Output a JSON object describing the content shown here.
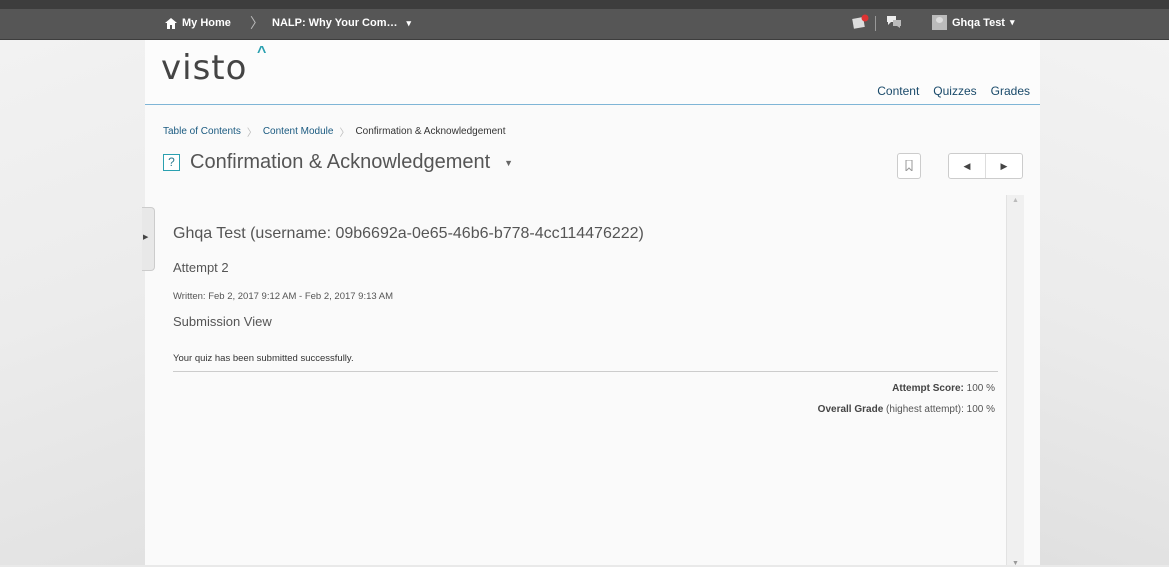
{
  "topbar": {
    "home_label": "My Home",
    "course_label": "NALP: Why Your Com…",
    "user_name": "Ghqa Test",
    "dropdown_glyph": "▾"
  },
  "header": {
    "logo": "visto",
    "nav": [
      "Content",
      "Quizzes",
      "Grades"
    ]
  },
  "breadcrumb": {
    "items": [
      "Table of Contents",
      "Content Module"
    ],
    "current": "Confirmation & Acknowledgement"
  },
  "page": {
    "title": "Confirmation & Acknowledgement",
    "title_icon": "?"
  },
  "submission": {
    "user_line": "Ghqa Test (username: 09b6692a-0e65-46b6-b778-4cc114476222)",
    "attempt": "Attempt 2",
    "written": "Written: Feb 2, 2017 9:12 AM - Feb 2, 2017 9:13 AM",
    "view_title": "Submission View",
    "message": "Your quiz has been submitted successfully.",
    "attempt_score_label": "Attempt Score:",
    "attempt_score_value": "100 %",
    "overall_grade_label": "Overall Grade",
    "overall_grade_note": "(highest attempt):",
    "overall_grade_value": "100 %"
  },
  "icons": {
    "home": "home-icon",
    "alerts": "alerts-icon",
    "chat": "chat-icon",
    "bookmark": "bookmark-icon",
    "prev": "prev-arrow-icon",
    "next": "next-arrow-icon"
  },
  "colors": {
    "topbar": "#565656",
    "accent": "#2aa0b0",
    "link": "#1a5a80"
  }
}
